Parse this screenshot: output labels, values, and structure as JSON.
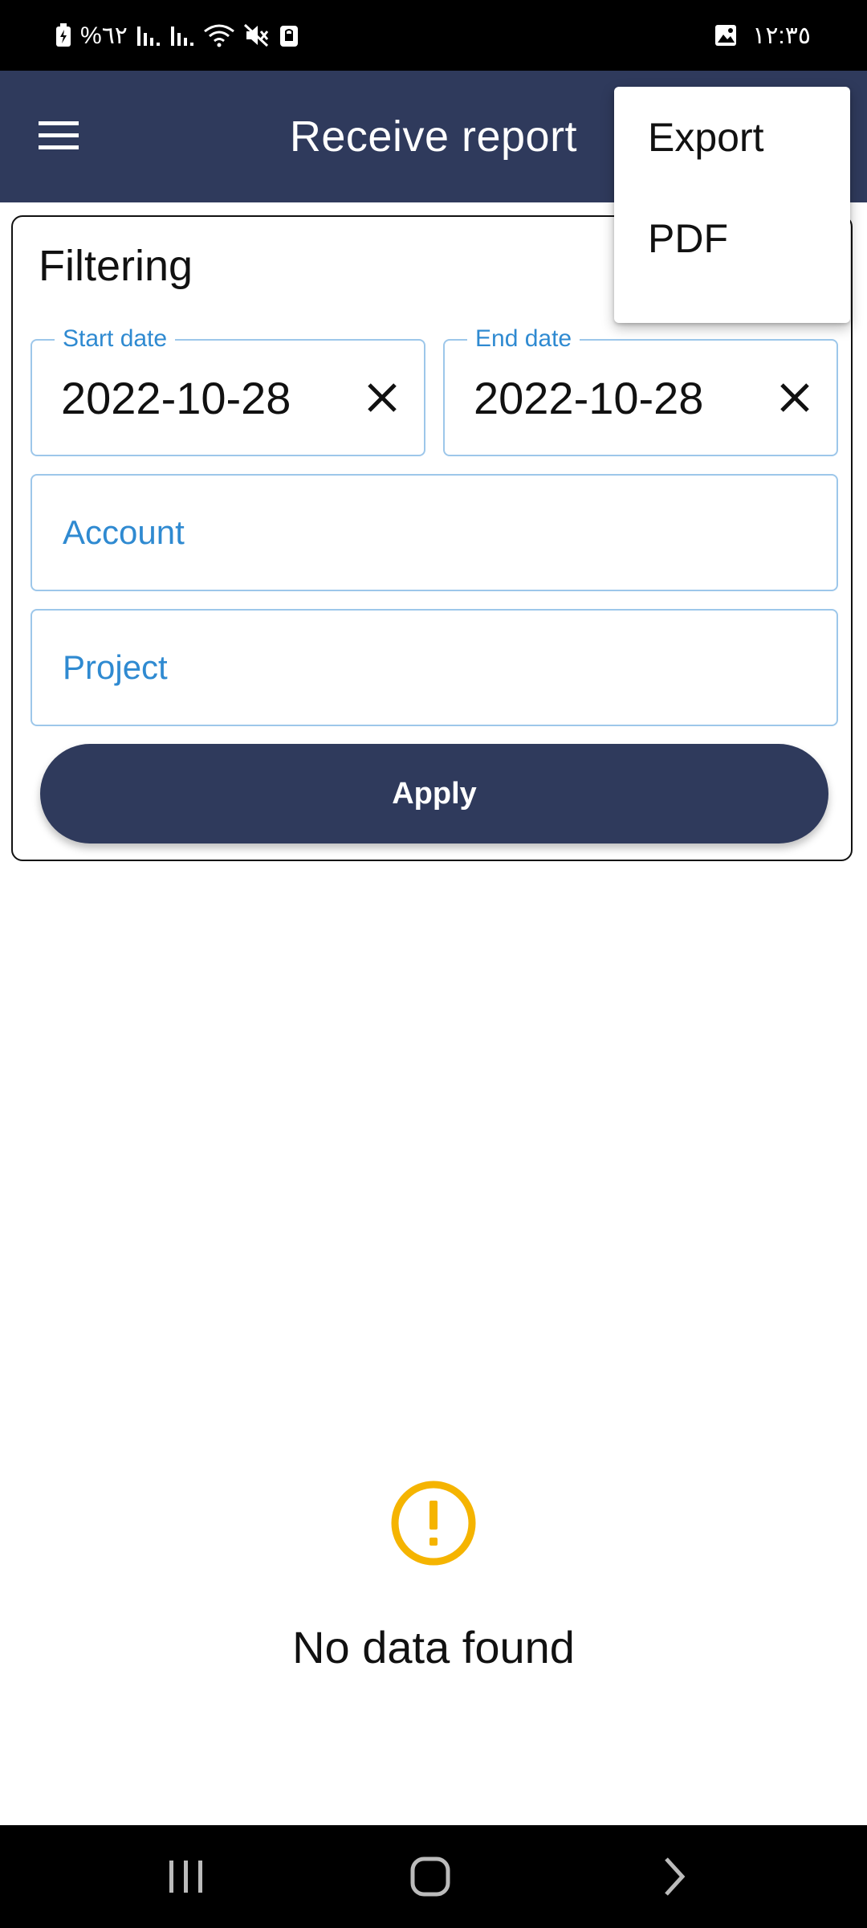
{
  "status_bar": {
    "battery_percent": "%٦٢",
    "time": "١٢:٣٥"
  },
  "app_bar": {
    "title": "Receive report"
  },
  "popup_menu": {
    "items": [
      {
        "label": "Export"
      },
      {
        "label": "PDF"
      }
    ]
  },
  "filter": {
    "title": "Filtering",
    "start_date": {
      "label": "Start date",
      "value": "2022-10-28"
    },
    "end_date": {
      "label": "End date",
      "value": "2022-10-28"
    },
    "account": {
      "placeholder": "Account"
    },
    "project": {
      "placeholder": "Project"
    },
    "apply_label": "Apply"
  },
  "empty_state": {
    "message": "No data found",
    "icon": "warning-circle-icon",
    "icon_color": "#f5b400"
  },
  "colors": {
    "primary": "#2f3a5c",
    "accent": "#2f8ad1",
    "field_border": "#9dc7ea"
  },
  "nav": {
    "icons": [
      "recents-icon",
      "home-icon",
      "back-icon"
    ]
  }
}
